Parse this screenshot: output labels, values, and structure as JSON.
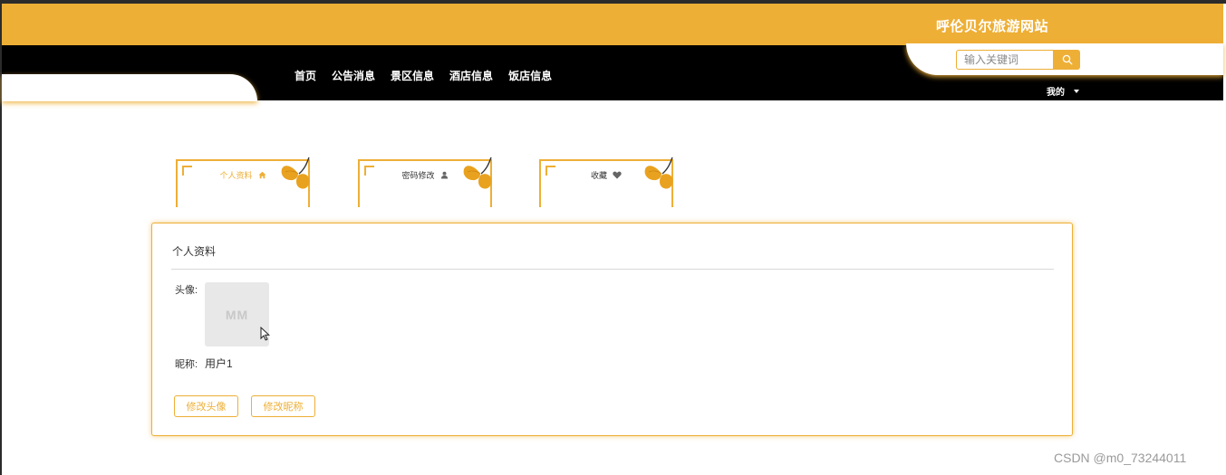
{
  "header": {
    "site_title": "呼伦贝尔旅游网站"
  },
  "nav": {
    "items": [
      "首页",
      "公告消息",
      "景区信息",
      "酒店信息",
      "饭店信息"
    ]
  },
  "search": {
    "placeholder": "输入关键词"
  },
  "user_menu": {
    "label": "我的"
  },
  "tabs": [
    {
      "label": "个人资料",
      "icon": "home-icon",
      "active": true
    },
    {
      "label": "密码修改",
      "icon": "user-icon",
      "active": false
    },
    {
      "label": "收藏",
      "icon": "heart-icon",
      "active": false
    }
  ],
  "profile": {
    "title": "个人资料",
    "avatar_label": "头像:",
    "avatar_placeholder": "MM",
    "nickname_label": "昵称:",
    "nickname_value": "用户1",
    "change_avatar_button": "修改头像",
    "change_nickname_button": "修改昵称"
  },
  "watermark": "CSDN @m0_73244011",
  "colors": {
    "accent": "#EEAF36",
    "nav_bg": "#000000",
    "avatar_bg": "#E8E8E8"
  }
}
